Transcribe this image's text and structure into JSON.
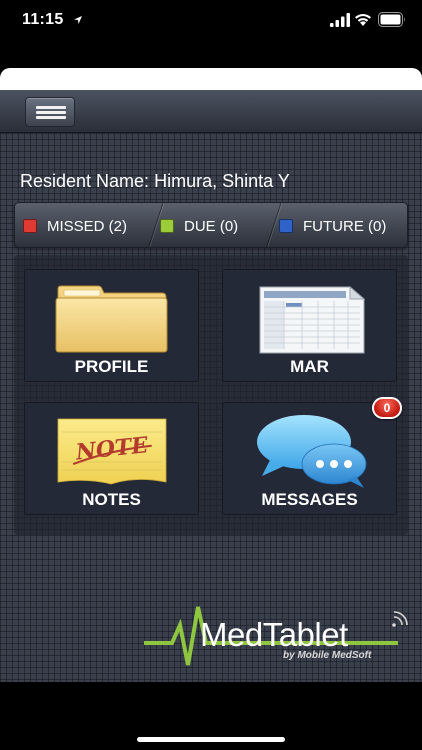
{
  "status_bar": {
    "time": "11:15"
  },
  "toolbar": {
    "menu_icon": "hamburger-menu-icon"
  },
  "resident": {
    "label": "Resident Name:",
    "name": "Himura, Shinta Y"
  },
  "status_tabs": [
    {
      "label": "MISSED (2)",
      "color": "#e03a35"
    },
    {
      "label": "DUE (0)",
      "color": "#9ccc3a"
    },
    {
      "label": "FUTURE (0)",
      "color": "#2f63c9"
    }
  ],
  "tiles": {
    "profile": {
      "label": "PROFILE",
      "icon": "folder-icon"
    },
    "mar": {
      "label": "MAR",
      "icon": "spreadsheet-icon"
    },
    "notes": {
      "label": "NOTES",
      "icon": "sticky-note-icon",
      "note_text": "NOTE"
    },
    "messages": {
      "label": "MESSAGES",
      "icon": "chat-bubbles-icon",
      "badge": "0"
    }
  },
  "logo": {
    "name": "MedTablet",
    "tagline": "by Mobile MedSoft"
  }
}
